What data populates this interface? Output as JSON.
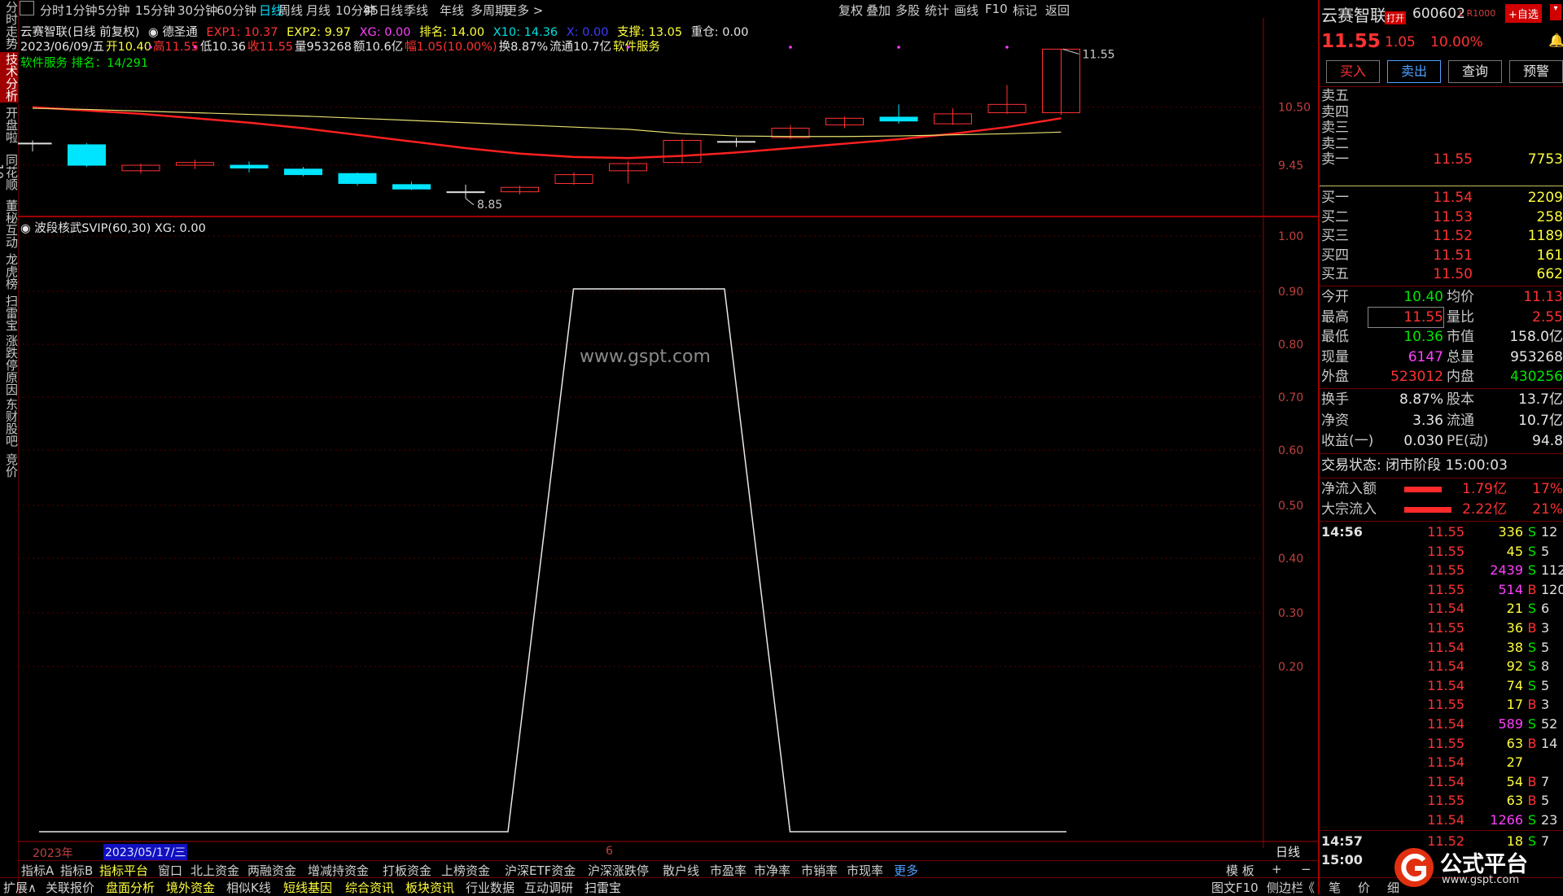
{
  "left_nav": [
    "分时走势",
    "技术分析",
    "开盘啦",
    "同花顺10",
    "董秘互动",
    "龙虎榜",
    "扫雷宝",
    "涨跌停原因",
    "东财股吧",
    "竞价"
  ],
  "toolbar": {
    "periods": [
      "分时",
      "1分钟",
      "5分钟",
      "15分钟",
      "30分钟",
      "60分钟",
      "日线",
      "周线",
      "月线",
      "10分钟",
      "45日线",
      "季线",
      "年线",
      "多周期",
      "更多 >"
    ],
    "right": [
      "复权",
      "叠加",
      "多股",
      "统计",
      "画线",
      "F10",
      "标记",
      "返回"
    ]
  },
  "main": {
    "header1": {
      "name": "云赛智联(日线 前复权)",
      "indicator": "德圣通",
      "exp1": "EXP1: 10.37",
      "exp2": "EXP2: 9.97",
      "xg": "XG: 0.00",
      "rank": "排名: 14.00",
      "x10": "X10: 14.36",
      "x": "X: 0.00",
      "support": "支撑: 13.05",
      "pos": "重仓: 0.00"
    },
    "header2": {
      "date": "2023/06/09/五",
      "open": "开10.40",
      "high": "高11.55",
      "low": "低10.36",
      "close": "收11.55",
      "vol": "量953268",
      "amt": "额10.6亿",
      "chg": "幅1.05(10.00%)",
      "turn": "换8.87%",
      "float": "流通10.7亿",
      "sector": "软件服务"
    },
    "header3": "软件服务 排名：14/291",
    "price_labels": [
      "10.50",
      "9.45"
    ],
    "hi_label": "11.55",
    "lo_label": "8.85",
    "sub_header": "波段核武SVIP(60,30) XG: 0.00",
    "sub_axis": [
      "1.00",
      "0.90",
      "0.80",
      "0.70",
      "0.60",
      "0.50",
      "0.40",
      "0.30",
      "0.20"
    ],
    "watermark": "www.gspt.com",
    "x_labels": {
      "year": "2023年",
      "cursor": "2023/05/17/三",
      "month": "6"
    },
    "right_label": "日线"
  },
  "bottom1": {
    "tabs": [
      "指标A",
      "指标B",
      "指标平台",
      "窗口",
      "北上资金",
      "两融资金",
      "增减持资金",
      "打板资金",
      "上榜资金",
      "沪深ETF资金",
      "沪深涨跌停",
      "散户线",
      "市盈率",
      "市净率",
      "市销率",
      "市现率",
      "更多"
    ],
    "right": [
      "模 板",
      "+",
      "−"
    ]
  },
  "bottom2": {
    "tabs": [
      "扩展∧",
      "关联报价",
      "盘面分析",
      "境外资金",
      "相似K线",
      "短线基因",
      "综合资讯",
      "板块资讯",
      "行业数据",
      "互动调研",
      "扫雷宝"
    ],
    "right": [
      "图文F10",
      "侧边栏",
      "《"
    ],
    "far": [
      "笔",
      "价",
      "细"
    ]
  },
  "right": {
    "name": "云赛智联",
    "open_tag": "打开",
    "code": "600602",
    "lv": "L R1000",
    "add": "+自选",
    "price": "11.55",
    "chg": "1.05",
    "pct": "10.00%",
    "buttons": [
      "买入",
      "卖出",
      "查询",
      "预警"
    ],
    "sells": [
      [
        "卖五",
        "",
        ""
      ],
      [
        "卖四",
        "",
        ""
      ],
      [
        "卖三",
        "",
        ""
      ],
      [
        "卖二",
        "",
        ""
      ],
      [
        "卖一",
        "11.55",
        "7753"
      ]
    ],
    "buys": [
      [
        "买一",
        "11.54",
        "2209"
      ],
      [
        "买二",
        "11.53",
        "258"
      ],
      [
        "买三",
        "11.52",
        "1189"
      ],
      [
        "买四",
        "11.51",
        "161"
      ],
      [
        "买五",
        "11.50",
        "662"
      ]
    ],
    "stats": [
      [
        "今开",
        "10.40",
        "均价",
        "11.13"
      ],
      [
        "最高",
        "11.55",
        "量比",
        "2.55"
      ],
      [
        "最低",
        "10.36",
        "市值",
        "158.0亿"
      ],
      [
        "现量",
        "6147",
        "总量",
        "953268"
      ],
      [
        "外盘",
        "523012",
        "内盘",
        "430256"
      ]
    ],
    "stats2": [
      [
        "换手",
        "8.87%",
        "股本",
        "13.7亿"
      ],
      [
        "净资",
        "3.36",
        "流通",
        "10.7亿"
      ],
      [
        "收益(一)",
        "0.030",
        "PE(动)",
        "94.8"
      ]
    ],
    "status": "交易状态: 闭市阶段 15:00:03",
    "flows": [
      [
        "净流入额",
        "1.79亿",
        "17%"
      ],
      [
        "大宗流入",
        "2.22亿",
        "21%"
      ]
    ],
    "ticks_time": "14:56",
    "ticks": [
      [
        "11.55",
        "336",
        "S",
        "12"
      ],
      [
        "11.55",
        "45",
        "S",
        "5"
      ],
      [
        "11.55",
        "2439",
        "S",
        "112"
      ],
      [
        "11.55",
        "514",
        "B",
        "120"
      ],
      [
        "11.54",
        "21",
        "S",
        "6"
      ],
      [
        "11.55",
        "36",
        "B",
        "3"
      ],
      [
        "11.54",
        "38",
        "S",
        "5"
      ],
      [
        "11.54",
        "92",
        "S",
        "8"
      ],
      [
        "11.54",
        "74",
        "S",
        "5"
      ],
      [
        "11.55",
        "17",
        "B",
        "3"
      ],
      [
        "11.54",
        "589",
        "S",
        "52"
      ],
      [
        "11.55",
        "63",
        "B",
        "14"
      ],
      [
        "11.54",
        "27",
        "",
        ""
      ],
      [
        "11.54",
        "54",
        "B",
        "7"
      ],
      [
        "11.55",
        "63",
        "B",
        "5"
      ],
      [
        "11.54",
        "1266",
        "S",
        "23"
      ]
    ],
    "t1457": [
      "14:57",
      "11.52",
      "18",
      "S",
      "7"
    ],
    "t1500": "15:00",
    "logo": "公式平台",
    "logo_url": "www.gspt.com"
  },
  "chart_data": {
    "type": "candlestick",
    "candles": [
      {
        "o": 9.85,
        "c": 9.85,
        "h": 9.9,
        "l": 9.7
      },
      {
        "o": 9.82,
        "c": 9.45,
        "h": 9.85,
        "l": 9.42
      },
      {
        "o": 9.35,
        "c": 9.45,
        "h": 9.48,
        "l": 9.3
      },
      {
        "o": 9.45,
        "c": 9.5,
        "h": 9.55,
        "l": 9.38
      },
      {
        "o": 9.45,
        "c": 9.4,
        "h": 9.52,
        "l": 9.32
      },
      {
        "o": 9.38,
        "c": 9.28,
        "h": 9.42,
        "l": 9.25
      },
      {
        "o": 9.3,
        "c": 9.12,
        "h": 9.32,
        "l": 9.08
      },
      {
        "o": 9.1,
        "c": 9.02,
        "h": 9.15,
        "l": 9.0
      },
      {
        "o": 8.97,
        "c": 8.97,
        "h": 9.1,
        "l": 8.85
      },
      {
        "o": 8.97,
        "c": 9.05,
        "h": 9.08,
        "l": 8.92
      },
      {
        "o": 9.12,
        "c": 9.28,
        "h": 9.32,
        "l": 9.1
      },
      {
        "o": 9.35,
        "c": 9.48,
        "h": 9.52,
        "l": 9.12
      },
      {
        "o": 9.5,
        "c": 9.9,
        "h": 9.92,
        "l": 9.48
      },
      {
        "o": 9.88,
        "c": 9.88,
        "h": 9.95,
        "l": 9.78
      },
      {
        "o": 9.95,
        "c": 10.12,
        "h": 10.18,
        "l": 9.92
      },
      {
        "o": 10.18,
        "c": 10.3,
        "h": 10.33,
        "l": 10.12
      },
      {
        "o": 10.32,
        "c": 10.25,
        "h": 10.55,
        "l": 10.2
      },
      {
        "o": 10.2,
        "c": 10.38,
        "h": 10.48,
        "l": 10.18
      },
      {
        "o": 10.4,
        "c": 10.55,
        "h": 10.9,
        "l": 10.38
      },
      {
        "o": 10.4,
        "c": 11.55,
        "h": 11.55,
        "l": 10.36
      }
    ],
    "ma_red": [
      10.5,
      10.44,
      10.38,
      10.3,
      10.22,
      10.12,
      10.0,
      9.88,
      9.76,
      9.66,
      9.6,
      9.58,
      9.62,
      9.68,
      9.76,
      9.84,
      9.92,
      10.02,
      10.14,
      10.3
    ],
    "ma_yellow": [
      10.48,
      10.46,
      10.43,
      10.4,
      10.37,
      10.34,
      10.3,
      10.26,
      10.22,
      10.18,
      10.14,
      10.1,
      10.02,
      9.98,
      9.97,
      9.97,
      9.98,
      10.0,
      10.02,
      10.05
    ],
    "price_ylim": [
      8.7,
      11.6
    ],
    "sub_series": [
      0,
      0,
      0,
      0,
      0,
      0,
      0,
      0,
      0,
      1,
      1,
      1,
      1,
      0,
      0,
      0,
      0,
      0,
      0,
      0
    ],
    "sub_ylim": [
      0,
      1
    ]
  }
}
